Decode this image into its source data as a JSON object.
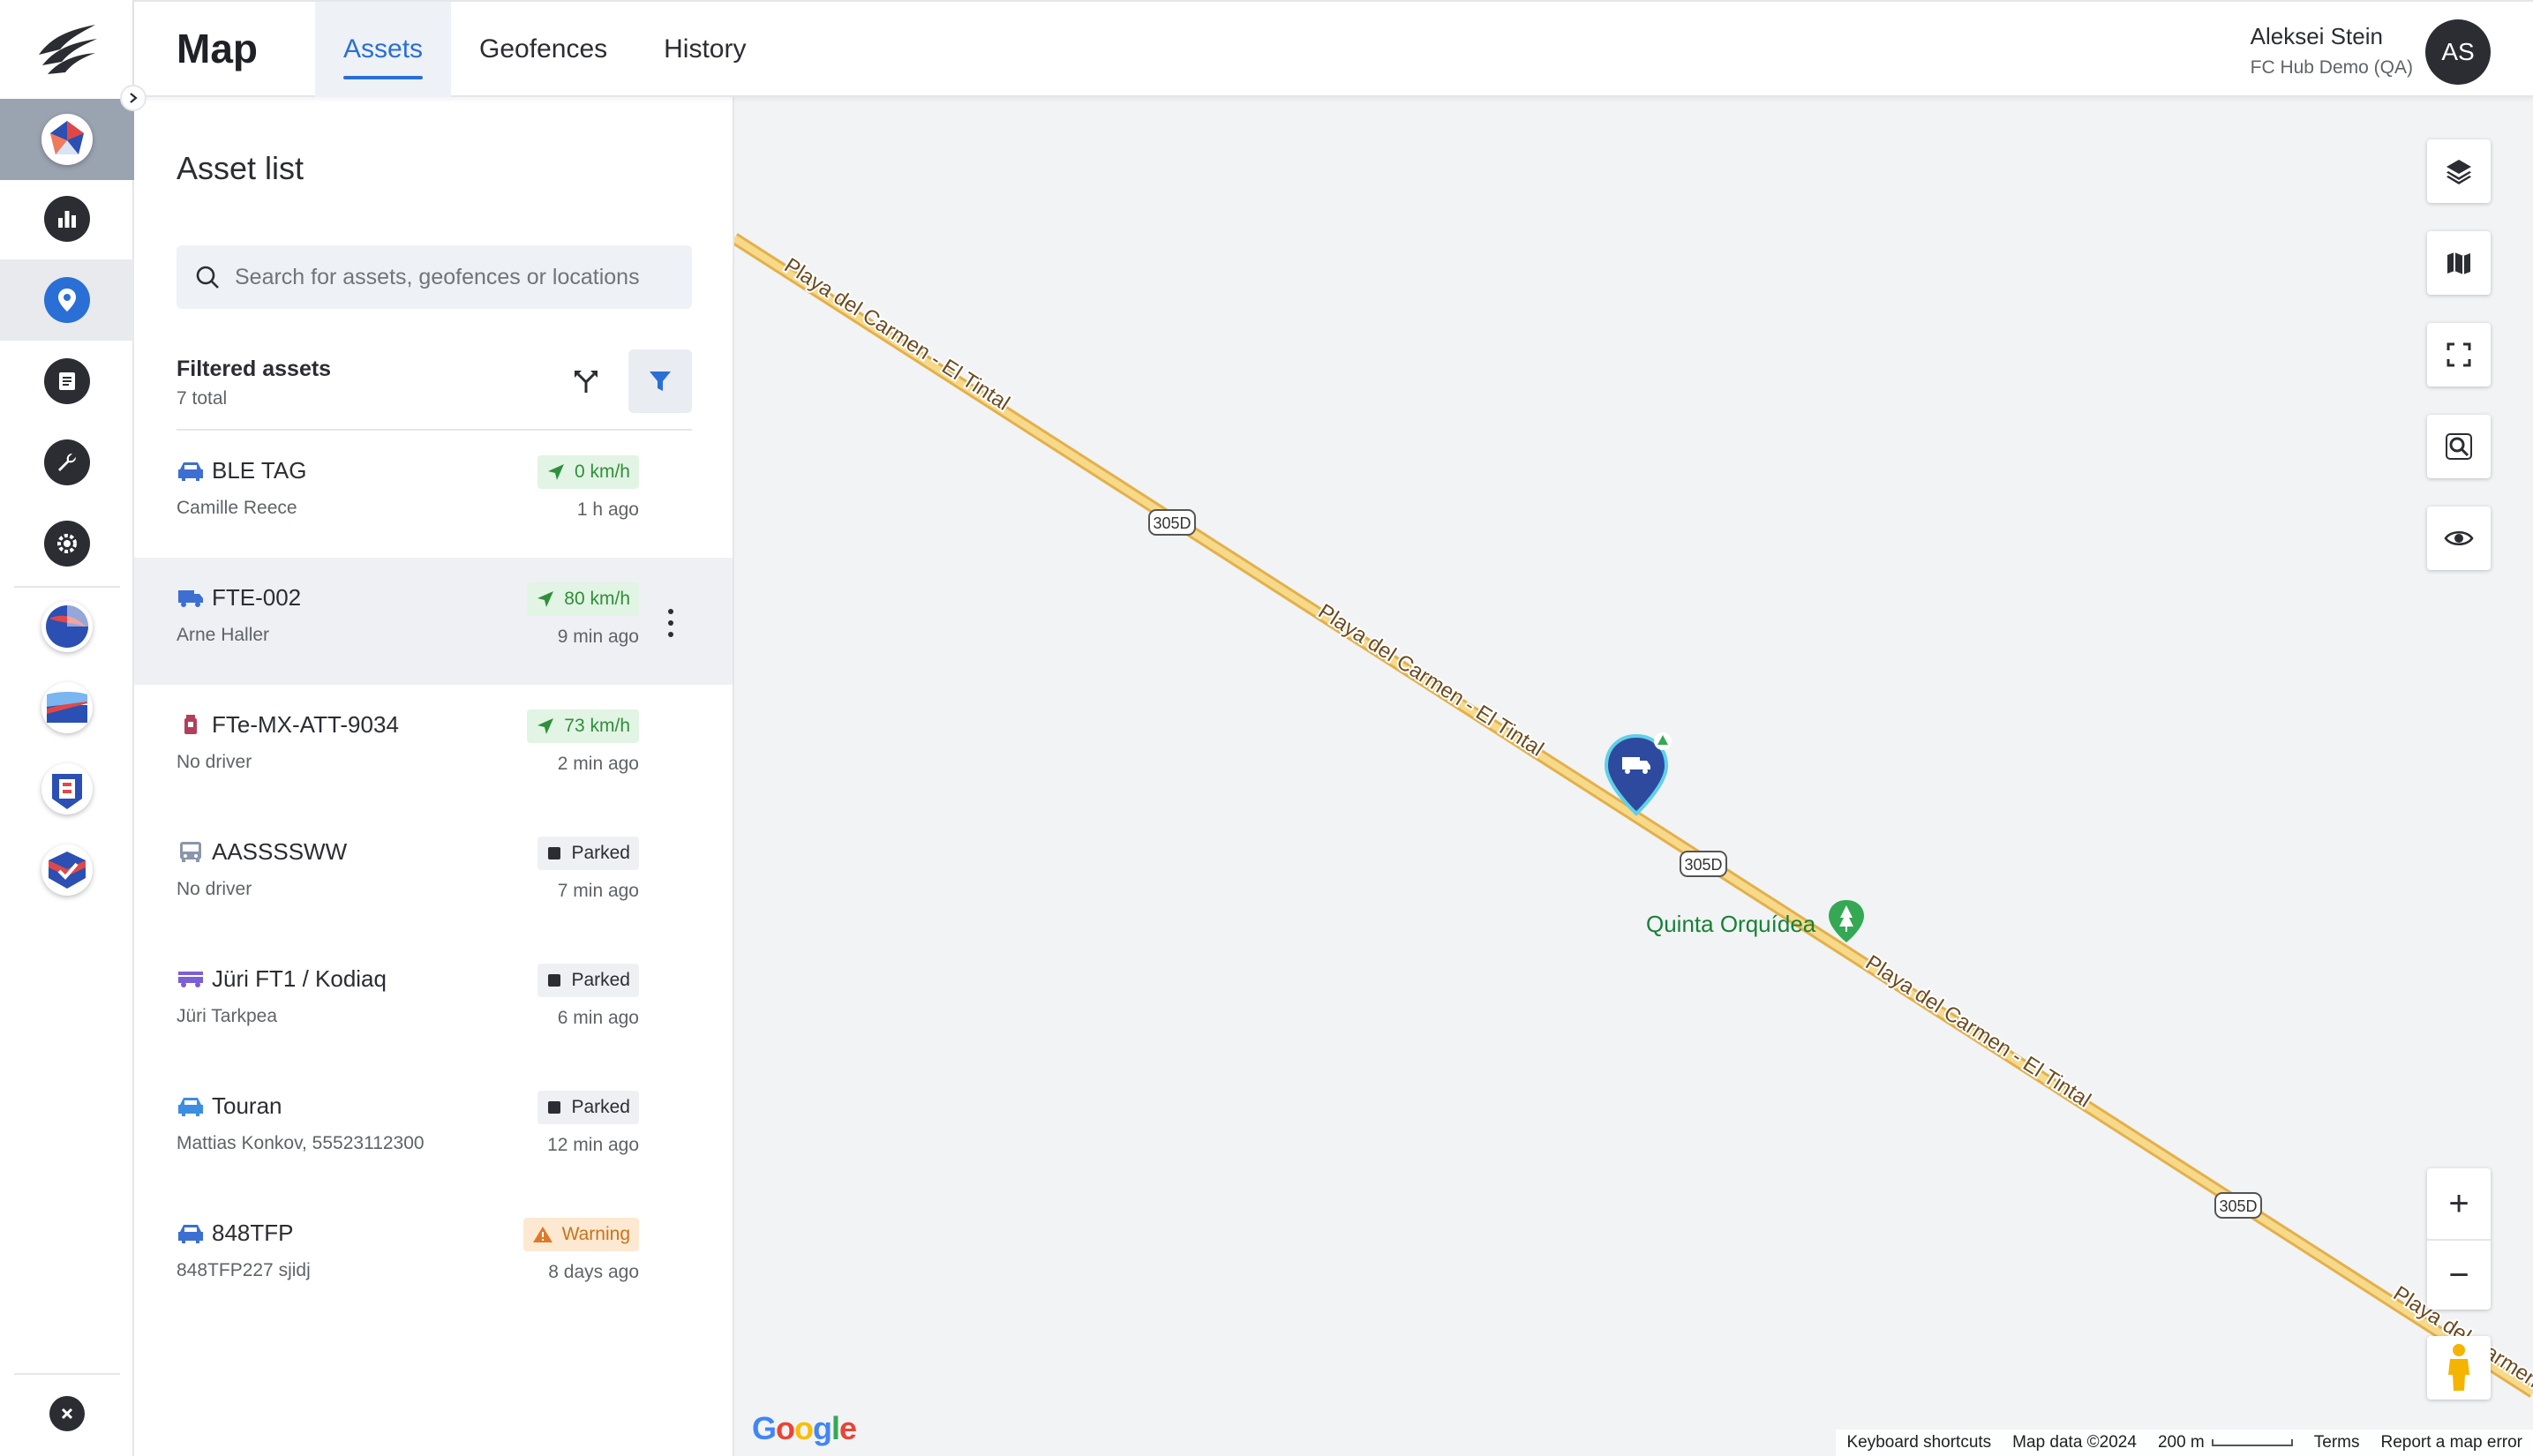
{
  "header": {
    "page_title": "Map",
    "tabs": [
      {
        "label": "Assets",
        "active": true
      },
      {
        "label": "Geofences",
        "active": false
      },
      {
        "label": "History",
        "active": false
      }
    ],
    "user_name": "Aleksei Stein",
    "user_org": "FC Hub Demo (QA)",
    "avatar_initials": "AS"
  },
  "rail": {
    "items": [
      "fleet-app-icon",
      "dashboard-icon",
      "map-pin-icon",
      "reports-icon",
      "wrench-icon",
      "settings-icon"
    ],
    "apps": [
      "app-1-icon",
      "app-2-icon",
      "app-3-icon",
      "app-4-icon"
    ],
    "close": "close-icon"
  },
  "panel": {
    "title": "Asset list",
    "search_placeholder": "Search for assets, geofences or locations",
    "filtered_title": "Filtered assets",
    "filtered_count": "7 total"
  },
  "assets": [
    {
      "name": "BLE TAG",
      "driver": "Camille Reece",
      "status": "0 km/h",
      "status_type": "moving",
      "time": "1 h ago",
      "icon_color": "#3c6fd1"
    },
    {
      "name": "FTE-002",
      "driver": "Arne Haller",
      "status": "80 km/h",
      "status_type": "moving",
      "time": "9 min ago",
      "icon_color": "#3c6fd1"
    },
    {
      "name": "FTe-MX-ATT-9034",
      "driver": "No driver",
      "status": "73 km/h",
      "status_type": "moving",
      "time": "2 min ago",
      "icon_color": "#b2405a"
    },
    {
      "name": "AASSSSWW",
      "driver": "No driver",
      "status": "Parked",
      "status_type": "parked",
      "time": "7 min ago",
      "icon_color": "#8a96aa"
    },
    {
      "name": "Jüri FT1 / Kodiaq",
      "driver": "Jüri Tarkpea",
      "status": "Parked",
      "status_type": "parked",
      "time": "6 min ago",
      "icon_color": "#7b5fd6"
    },
    {
      "name": "Touran",
      "driver": "Mattias Konkov, 55523112300",
      "status": "Parked",
      "status_type": "parked",
      "time": "12 min ago",
      "icon_color": "#3c8ee0"
    },
    {
      "name": "848TFP",
      "driver": "848TFP227 sjidj",
      "status": "Warning",
      "status_type": "warning",
      "time": "8 days ago",
      "icon_color": "#3c6fd1"
    }
  ],
  "map": {
    "road_name": "Playa del Carmen - El Tintal",
    "road_label_truncated": "Playa del Carmen",
    "highway_shield": "305D",
    "poi": "Quinta Orquídea",
    "controls": [
      "layers-icon",
      "map-type-icon",
      "fullscreen-icon",
      "zoom-to-fit-icon",
      "visibility-icon"
    ],
    "zoom_in": "+",
    "zoom_out": "−",
    "google_logo": "Google",
    "footer": {
      "keyboard": "Keyboard shortcuts",
      "map_data": "Map data ©2024",
      "scale": "200 m",
      "terms": "Terms",
      "report": "Report a map error"
    }
  },
  "colors": {
    "accent": "#2a6fd6",
    "moving_bg": "#e2f4e4",
    "moving_fg": "#2f8f3a",
    "warning_bg": "#fde9d2",
    "warning_fg": "#c9731a",
    "road": "#f5d27a",
    "marker": "#2e4a9e"
  }
}
